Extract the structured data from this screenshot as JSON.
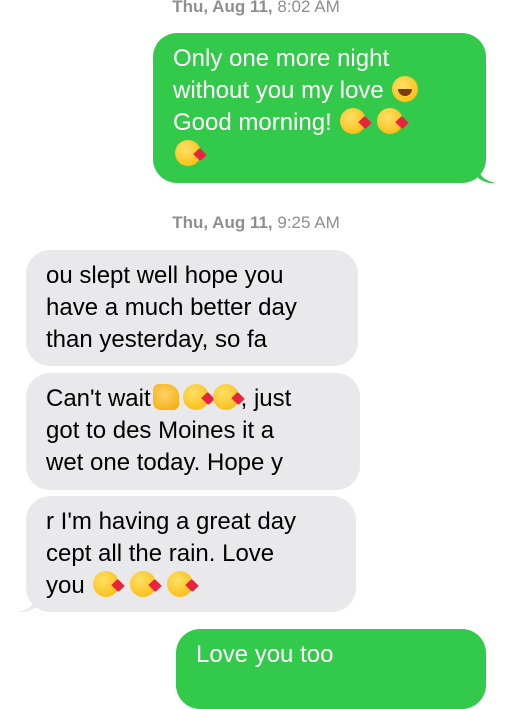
{
  "timestamps": [
    {
      "day": "Thu, Aug 11,",
      "time": " 8:02 AM"
    },
    {
      "day": "Thu, Aug 11,",
      "time": " 9:25 AM"
    }
  ],
  "messages": [
    {
      "direction": "outgoing",
      "text": "Only one more night\nwithout you my love",
      "emojis": [
        "grinning-face"
      ],
      "text2": "Good morning!",
      "emojis2": [
        "face-blowing-kiss",
        "face-blowing-kiss",
        "face-blowing-kiss"
      ]
    },
    {
      "direction": "incoming",
      "text": "ou slept well hope you\nhave a much better day\nthan yesterday, so fa"
    },
    {
      "direction": "incoming",
      "text_a": "Can't wait",
      "emojis": [
        "thumbs-up",
        "face-blowing-kiss",
        "face-blowing-kiss"
      ],
      "text_b": ", just\ngot to des Moines it a\nwet one today. Hope y"
    },
    {
      "direction": "incoming",
      "text": "r I'm having a great day\ncept all the rain. Love\nyou",
      "emojis": [
        "face-blowing-kiss",
        "face-blowing-kiss",
        "face-blowing-kiss"
      ]
    },
    {
      "direction": "outgoing",
      "text": "Love you too"
    }
  ],
  "colors": {
    "outgoing_bubble": "#33c94a",
    "incoming_bubble": "#e9e9eb",
    "timestamp": "#8e8e93"
  }
}
